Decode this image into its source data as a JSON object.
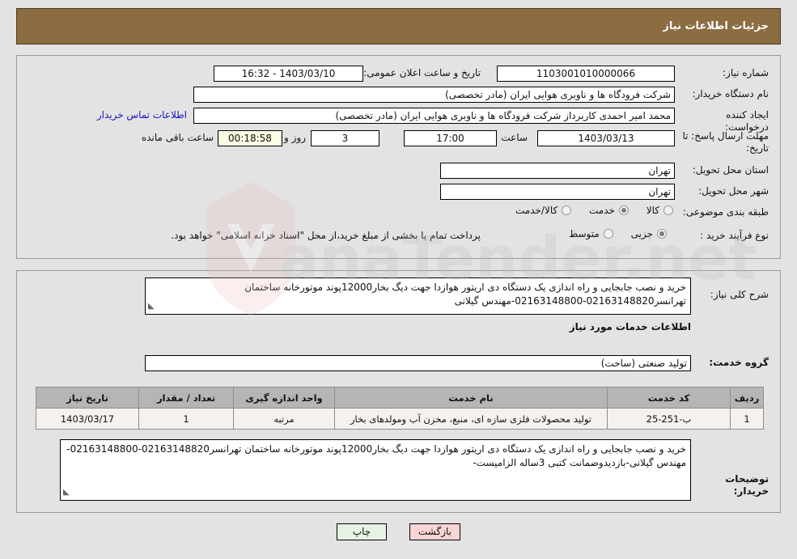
{
  "header": {
    "title": "جزئیات اطلاعات نیاز"
  },
  "top_panel": {
    "need_number_label": "شماره نیاز:",
    "need_number_value": "1103001010000066",
    "announce_label": "تاریخ و ساعت اعلان عمومی:",
    "announce_value": "1403/03/10 - 16:32",
    "buyer_org_label": "نام دستگاه خریدار:",
    "buyer_org_value": "شرکت فرودگاه ها و ناوبری هوایی ایران (مادر تخصصی)",
    "creator_label": "ایجاد کننده درخواست:",
    "creator_value": "محمد امیر احمدی کاربرداز شرکت فرودگاه ها و ناوبری هوایی ایران (مادر تخصصی)",
    "contact_link": "اطلاعات تماس خریدار",
    "deadline_label": "مهلت ارسال پاسخ: تا تاریخ:",
    "deadline_date": "1403/03/13",
    "hour_label": "ساعت",
    "hour_value": "17:00",
    "days_value": "3",
    "days_unit_label": "روز و",
    "countdown_value": "00:18:58",
    "countdown_suffix_label": "ساعت باقی مانده",
    "province_label": "استان محل تحویل:",
    "province_value": "تهران",
    "city_label": "شهر محل تحویل:",
    "city_value": "تهران",
    "category_label": "طبقه بندی موضوعی:",
    "category_options": [
      {
        "label": "کالا",
        "selected": false
      },
      {
        "label": "خدمت",
        "selected": true
      },
      {
        "label": "کالا/خدمت",
        "selected": false
      }
    ],
    "process_label": "نوع فرآیند خرید :",
    "process_options": [
      {
        "label": "جزیی",
        "selected": true
      },
      {
        "label": "متوسط",
        "selected": false
      }
    ],
    "treasury_note": "پرداخت تمام یا بخشی از مبلغ خرید،از محل \"اسناد خزانه اسلامی\" خواهد بود."
  },
  "bottom_panel": {
    "summary_label": "شرح کلی نیاز:",
    "summary_value": "خرید و نصب جابجایی و راه اندازی یک دستگاه دی اریتور هوازدا جهت دیگ بخار12000پوند موتورخانه ساختمان تهرانسر02163148820-02163148800-مهندس گیلانی",
    "services_info_title": "اطلاعات خدمات مورد نیاز",
    "service_group_label": "گروه خدمت:",
    "service_group_value": "تولید صنعتی (ساخت)",
    "table": {
      "columns": [
        "ردیف",
        "کد خدمت",
        "نام خدمت",
        "واحد اندازه گیری",
        "تعداد / مقدار",
        "تاریخ نیاز"
      ],
      "rows": [
        {
          "index": "1",
          "code": "ب-251-25",
          "name": "تولید محصولات فلزی سازه ای، منبع، مخزن آب ومولدهای بخار",
          "unit": "مرتبه",
          "quantity": "1",
          "date": "1403/03/17"
        }
      ]
    },
    "buyer_notes_label": "توضیحات خریدار:",
    "buyer_notes_value": "خرید و نصب جابجایی و راه اندازی یک دستگاه دی اریتور هوازدا جهت دیگ بخار12000پوند موتورخانه ساختمان تهرانسر02163148820-02163148800-مهندس گیلانی-بازدیدوضمانت کتبی 3ساله الزامیست-"
  },
  "footer": {
    "print_label": "چاپ",
    "back_label": "بازگشت"
  },
  "watermark": {
    "text": "anaTender.net"
  },
  "colors": {
    "header_bar": "#8c6d42",
    "page_background": "#e3e3e3",
    "table_header": "#b5b5b5",
    "link": "#1414c8",
    "back_button": "#fbd5d5",
    "print_button": "#e6f5e3",
    "countdown_field": "#fcfbe3"
  }
}
